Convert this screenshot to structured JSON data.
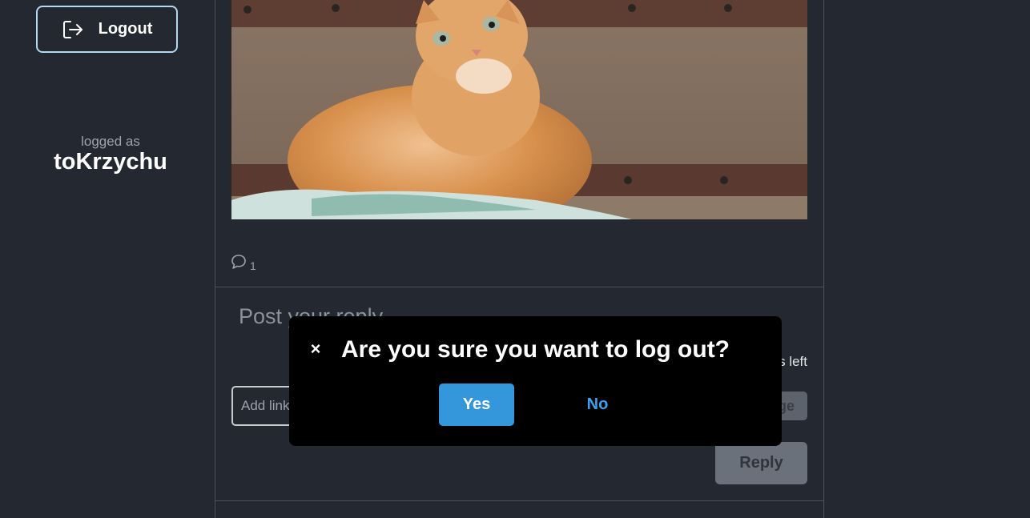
{
  "sidebar": {
    "logout_label": "Logout",
    "logged_as_label": "logged as",
    "username": "toKrzychu"
  },
  "post": {
    "image_icon": "cat-photo",
    "comment_icon": "speech-bubble-icon",
    "comment_count": "1"
  },
  "reply_form": {
    "heading": "Post your reply",
    "chars_left_suffix": "s left",
    "link_placeholder": "Add link",
    "image_button_partial": "ge",
    "reply_label": "Reply"
  },
  "modal": {
    "close_glyph": "×",
    "title": "Are you sure you want to log out?",
    "yes_label": "Yes",
    "no_label": "No"
  },
  "colors": {
    "background": "#242830",
    "accent": "#3497db",
    "modal_background": "#000000",
    "logout_border": "#b3d8f4"
  }
}
